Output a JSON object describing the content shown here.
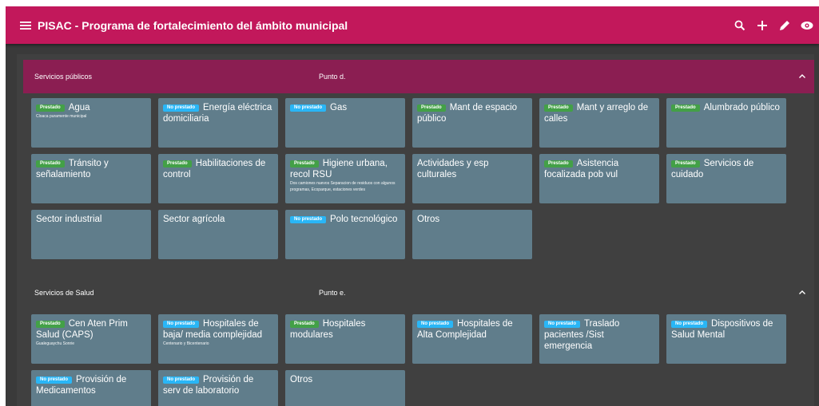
{
  "app": {
    "title": "PISAC - Programa de fortalecimiento del ámbito municipal"
  },
  "colors": {
    "appbar": "#c2185b",
    "section_header": "#8b1e52",
    "tile": "#607d8b",
    "prestado": "#43a047",
    "no_prestado": "#29b6f6"
  },
  "icons": [
    "menu-icon",
    "search-icon",
    "add-icon",
    "edit-icon",
    "visibility-icon",
    "chevron-up-icon"
  ],
  "sections": [
    {
      "name": "Servicios públicos",
      "point": "Punto d.",
      "tiles": [
        {
          "badge": "Prestado",
          "title": "Agua",
          "note": "Cloaca puramente municipal"
        },
        {
          "badge": "No prestado",
          "title": "Energía eléctrica domiciliaria",
          "note": ""
        },
        {
          "badge": "No prestado",
          "title": "Gas",
          "note": ""
        },
        {
          "badge": "Prestado",
          "title": "Mant de espacio público",
          "note": ""
        },
        {
          "badge": "Prestado",
          "title": "Mant y arreglo de calles",
          "note": ""
        },
        {
          "badge": "Prestado",
          "title": "Alumbrado público",
          "note": ""
        },
        {
          "badge": "Prestado",
          "title": "Tránsito y señalamiento",
          "note": ""
        },
        {
          "badge": "Prestado",
          "title": "Habilitaciones de control",
          "note": ""
        },
        {
          "badge": "Prestado",
          "title": "Higiene urbana, recol RSU",
          "note": "Dos camiones nuevos Separacion de residuos con algunos programas, Ecoparque, estaciones verdes"
        },
        {
          "badge": "",
          "title": "Actividades y esp culturales",
          "note": ""
        },
        {
          "badge": "Prestado",
          "title": "Asistencia focalizada pob vul",
          "note": ""
        },
        {
          "badge": "Prestado",
          "title": "Servicios de cuidado",
          "note": ""
        },
        {
          "badge": "",
          "title": "Sector industrial",
          "note": ""
        },
        {
          "badge": "",
          "title": "Sector agrícola",
          "note": ""
        },
        {
          "badge": "No prestado",
          "title": "Polo tecnológico",
          "note": ""
        },
        {
          "badge": "",
          "title": "Otros",
          "note": ""
        }
      ]
    },
    {
      "name": "Servicios de Salud",
      "point": "Punto e.",
      "tiles": [
        {
          "badge": "Prestado",
          "title": "Cen Aten Prim Salud (CAPS)",
          "note": "Gualeguaychu Sonrie"
        },
        {
          "badge": "No prestado",
          "title": "Hospitales de baja/ media complejidad",
          "note": "Centenario y Bicentenario"
        },
        {
          "badge": "Prestado",
          "title": "Hospitales modulares",
          "note": ""
        },
        {
          "badge": "No prestado",
          "title": "Hospitales de Alta Complejidad",
          "note": ""
        },
        {
          "badge": "No prestado",
          "title": "Traslado pacientes /Sist emergencia",
          "note": ""
        },
        {
          "badge": "No prestado",
          "title": "Dispositivos de Salud Mental",
          "note": ""
        },
        {
          "badge": "No prestado",
          "title": "Provisión de Medicamentos",
          "note": ""
        },
        {
          "badge": "No prestado",
          "title": "Provisión de serv de laboratorio",
          "note": ""
        },
        {
          "badge": "",
          "title": "Otros",
          "note": ""
        }
      ]
    }
  ]
}
